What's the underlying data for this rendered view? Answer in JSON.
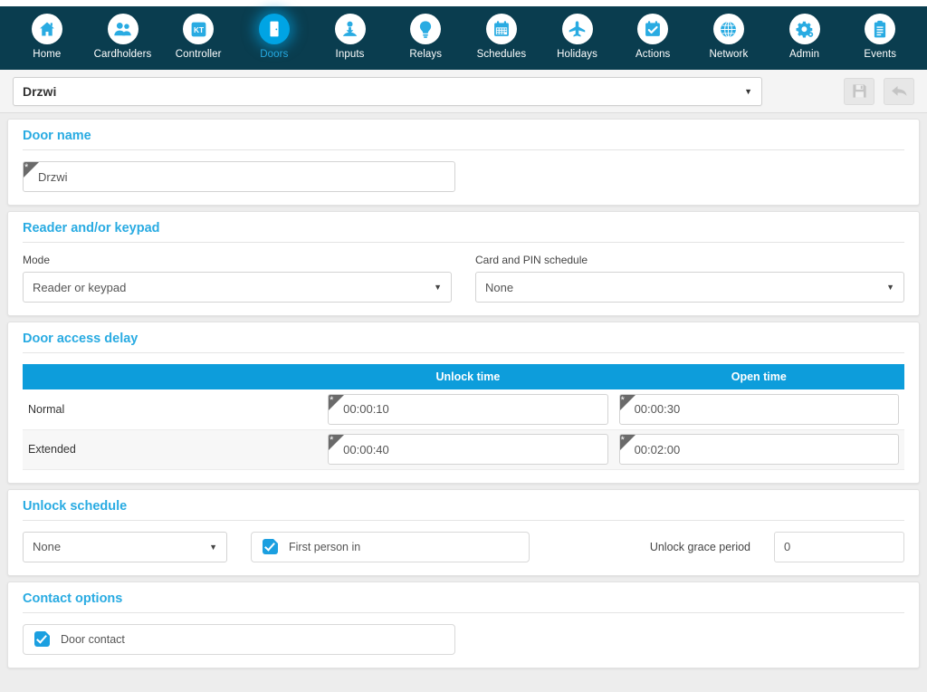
{
  "nav": {
    "items": [
      {
        "label": "Home",
        "icon": "home-icon",
        "active": false
      },
      {
        "label": "Cardholders",
        "icon": "cardholders-icon",
        "active": false
      },
      {
        "label": "Controller",
        "icon": "controller-kt-icon",
        "active": false
      },
      {
        "label": "Doors",
        "icon": "door-icon",
        "active": true
      },
      {
        "label": "Inputs",
        "icon": "inputs-icon",
        "active": false
      },
      {
        "label": "Relays",
        "icon": "relays-bulb-icon",
        "active": false
      },
      {
        "label": "Schedules",
        "icon": "calendar-icon",
        "active": false
      },
      {
        "label": "Holidays",
        "icon": "airplane-icon",
        "active": false
      },
      {
        "label": "Actions",
        "icon": "checked-calendar-icon",
        "active": false
      },
      {
        "label": "Network",
        "icon": "globe-icon",
        "active": false
      },
      {
        "label": "Admin",
        "icon": "gear-icon",
        "active": false
      },
      {
        "label": "Events",
        "icon": "clipboard-icon",
        "active": false
      }
    ]
  },
  "selector": {
    "value": "Drzwi",
    "caret": "▼",
    "save_icon": "save-floppy-icon",
    "undo_icon": "undo-arrow-icon"
  },
  "door_name": {
    "title": "Door name",
    "value": "Drzwi",
    "required_marker": "*"
  },
  "reader": {
    "title": "Reader and/or keypad",
    "mode_label": "Mode",
    "mode_value": "Reader or keypad",
    "schedule_label": "Card and PIN schedule",
    "schedule_value": "None",
    "caret": "▼"
  },
  "access_delay": {
    "title": "Door access delay",
    "columns": [
      "",
      "Unlock time",
      "Open time"
    ],
    "rows": [
      {
        "label": "Normal",
        "unlock_time": "00:00:10",
        "open_time": "00:00:30"
      },
      {
        "label": "Extended",
        "unlock_time": "00:00:40",
        "open_time": "00:02:00"
      }
    ],
    "required_marker": "*"
  },
  "unlock_schedule": {
    "title": "Unlock schedule",
    "schedule_value": "None",
    "caret": "▼",
    "first_person_label": "First person in",
    "first_person_checked": true,
    "grace_label": "Unlock grace period",
    "grace_value": "0"
  },
  "contact_options": {
    "title": "Contact options",
    "door_contact_label": "Door contact",
    "door_contact_checked": true
  },
  "colors": {
    "navbar": "#0a3d4f",
    "accent": "#29abe2",
    "table_header": "#0d9ddb",
    "active_circle": "#00a4e4",
    "page_bg": "#ededed"
  }
}
